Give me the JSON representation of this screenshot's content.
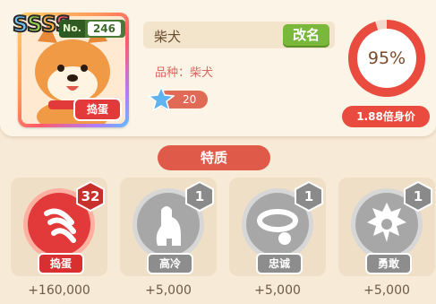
{
  "pet": {
    "number_prefix": "No.",
    "number": "246",
    "rank": [
      "S",
      "S",
      "S",
      "S"
    ],
    "rank_colors": [
      "#6fc6ff",
      "#9bd94d",
      "#ffb63f",
      "#ff5a6a"
    ],
    "badge": "捣蛋",
    "name": "柴犬",
    "rename_label": "改名",
    "breed": "品种：柴犬",
    "level": "20",
    "value_percent": "95%",
    "value_fraction": 0.95,
    "multiplier": "1.88倍身价"
  },
  "traits": {
    "title": "特质",
    "items": [
      {
        "label": "捣蛋",
        "count": "32",
        "value": "+160,000",
        "icon": "scratch-claw-icon",
        "active": true
      },
      {
        "label": "高冷",
        "count": "1",
        "value": "+5,000",
        "icon": "sitting-dog-icon",
        "active": false
      },
      {
        "label": "忠诚",
        "count": "1",
        "value": "+5,000",
        "icon": "collar-icon",
        "active": false
      },
      {
        "label": "勇敢",
        "count": "1",
        "value": "+5,000",
        "icon": "paw-burst-icon",
        "active": false
      }
    ]
  },
  "colors": {
    "accent_red": "#e94c3e",
    "active_circle": "#e23a3a",
    "inactive_circle": "#a7a7a7",
    "green": "#79b83a"
  }
}
